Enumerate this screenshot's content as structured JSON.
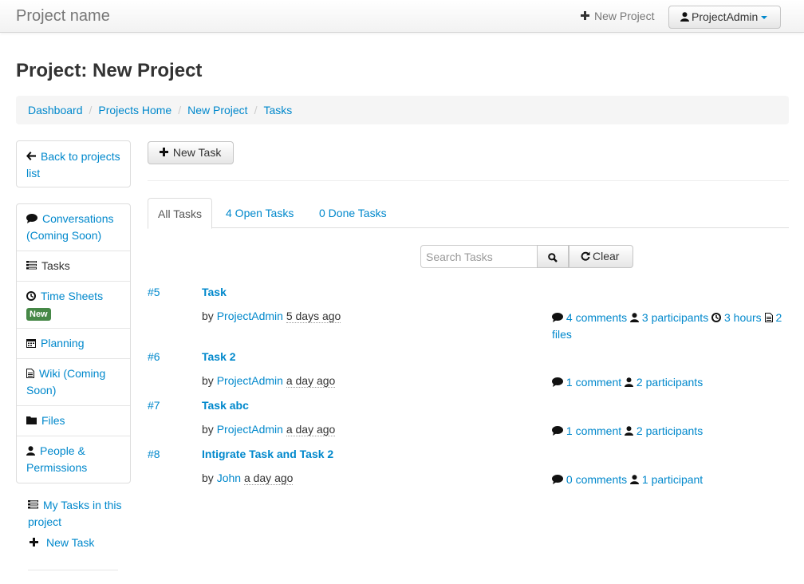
{
  "navbar": {
    "brand": "Project name",
    "new_project_label": "New Project",
    "user_label": "ProjectAdmin"
  },
  "page_title": "Project: New Project",
  "breadcrumb": [
    "Dashboard",
    "Projects Home",
    "New Project",
    "Tasks"
  ],
  "sidebar": {
    "back_label": "Back to projects list",
    "items": [
      {
        "label": "Conversations (Coming Soon)",
        "icon": "comment-icon"
      },
      {
        "label": "Tasks",
        "icon": "tasks-icon"
      },
      {
        "label": "Time Sheets",
        "icon": "clock-icon",
        "badge": "New"
      },
      {
        "label": "Planning",
        "icon": "calendar-icon"
      },
      {
        "label": "Wiki (Coming Soon)",
        "icon": "file-icon"
      },
      {
        "label": "Files",
        "icon": "folder-icon"
      },
      {
        "label": "People & Permissions",
        "icon": "user-icon"
      }
    ],
    "extra": {
      "my_tasks": "My Tasks in this project",
      "new_task": "New Task"
    }
  },
  "main": {
    "new_task_button": "New Task",
    "tabs": [
      "All Tasks",
      "4 Open Tasks",
      "0 Done Tasks"
    ],
    "search_placeholder": "Search Tasks",
    "clear_label": "Clear",
    "tasks": [
      {
        "num": "#5",
        "title": "Task",
        "by": "by",
        "author": "ProjectAdmin",
        "time": "5 days ago",
        "comments": "4 comments",
        "participants": "3 participants",
        "hours": "3 hours",
        "files": "2 files"
      },
      {
        "num": "#6",
        "title": "Task 2",
        "by": "by",
        "author": "ProjectAdmin",
        "time": "a day ago",
        "comments": "1 comment",
        "participants": "2 participants"
      },
      {
        "num": "#7",
        "title": "Task abc",
        "by": "by",
        "author": "ProjectAdmin",
        "time": "a day ago",
        "comments": "1 comment",
        "participants": "2 participants"
      },
      {
        "num": "#8",
        "title": "Intigrate Task and Task 2",
        "by": "by",
        "author": "John",
        "time": "a day ago",
        "comments": "0 comments",
        "participants": "1 participant"
      }
    ]
  },
  "colors": {
    "link": "#0088cc",
    "badge_new": "#468847",
    "text": "#333333"
  }
}
